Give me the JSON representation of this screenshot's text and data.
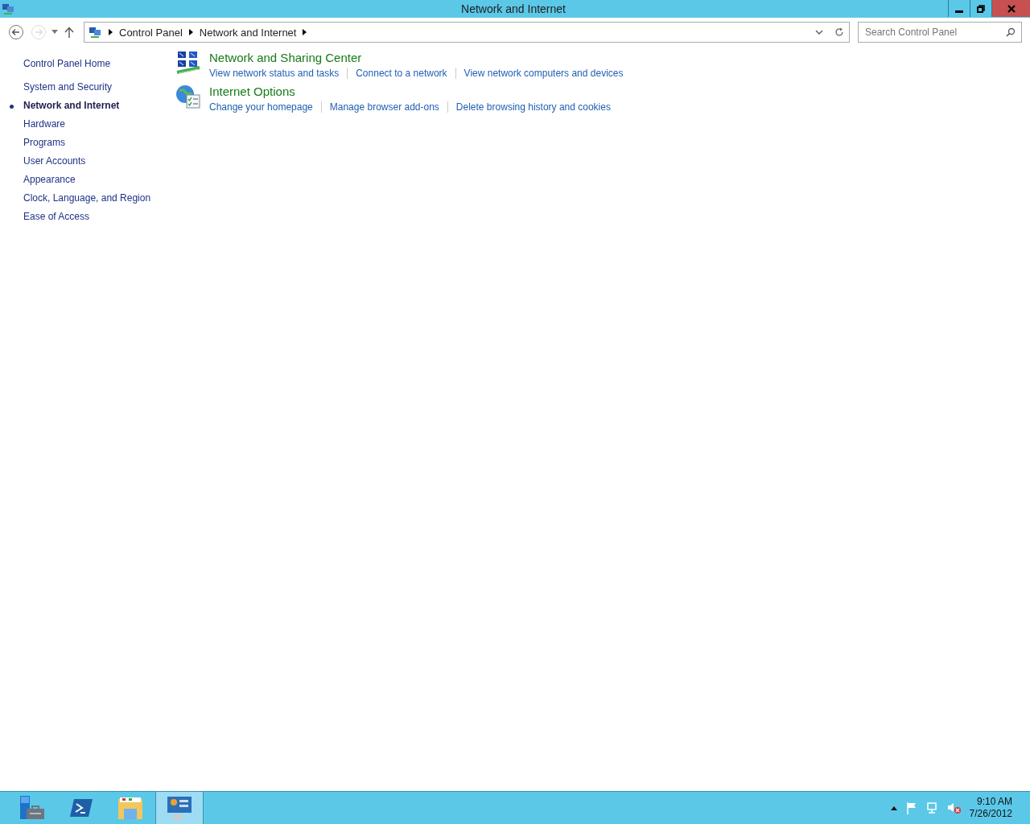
{
  "window": {
    "title": "Network and Internet"
  },
  "address_bar": {
    "breadcrumbs": [
      "Control Panel",
      "Network and Internet"
    ]
  },
  "search": {
    "placeholder": "Search Control Panel"
  },
  "sidebar": {
    "home": "Control Panel Home",
    "items": [
      {
        "label": "System and Security",
        "selected": false
      },
      {
        "label": "Network and Internet",
        "selected": true
      },
      {
        "label": "Hardware",
        "selected": false
      },
      {
        "label": "Programs",
        "selected": false
      },
      {
        "label": "User Accounts",
        "selected": false
      },
      {
        "label": "Appearance",
        "selected": false
      },
      {
        "label": "Clock, Language, and Region",
        "selected": false
      },
      {
        "label": "Ease of Access",
        "selected": false
      }
    ]
  },
  "categories": [
    {
      "kind": "network",
      "title": "Network and Sharing Center",
      "links": [
        "View network status and tasks",
        "Connect to a network",
        "View network computers and devices"
      ]
    },
    {
      "kind": "internet",
      "title": "Internet Options",
      "links": [
        "Change your homepage",
        "Manage browser add-ons",
        "Delete browsing history and cookies"
      ]
    }
  ],
  "taskbar": {
    "apps": [
      {
        "kind": "server",
        "selected": false
      },
      {
        "kind": "shell",
        "selected": false
      },
      {
        "kind": "folder",
        "selected": false
      },
      {
        "kind": "control",
        "selected": true
      }
    ],
    "clock": {
      "time": "9:10 AM",
      "date": "7/26/2012"
    }
  }
}
